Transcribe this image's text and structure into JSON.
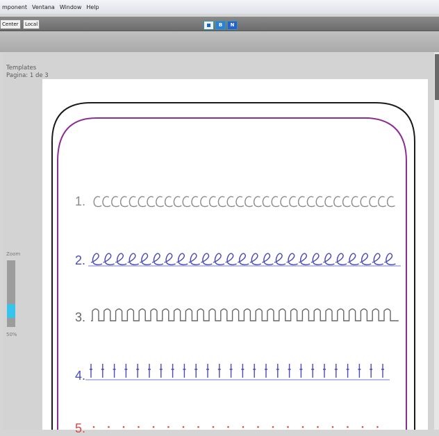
{
  "menubar": {
    "items": [
      "mponent",
      "Ventana",
      "Window",
      "Help"
    ]
  },
  "toolbar": {
    "combo_left": "Center",
    "combo_local": "Local",
    "view_buttons": [
      "",
      "B",
      "N"
    ]
  },
  "side_panel": {
    "title": "Templates",
    "page_info": "Pagina: 1 de 3",
    "zoom_label": "Zoom",
    "zoom_value": "50%",
    "zoom_level": 0.5
  },
  "worksheet": {
    "rows": [
      {
        "number": "1.",
        "pattern": "c-loops",
        "color": "#8a8a8a"
      },
      {
        "number": "2.",
        "pattern": "e-loops",
        "color": "#4a4ab8"
      },
      {
        "number": "3.",
        "pattern": "arches",
        "color": "#666666"
      },
      {
        "number": "4.",
        "pattern": "sticks",
        "color": "#4a4ab8"
      },
      {
        "number": "5.",
        "pattern": "dots",
        "color": "#e04646"
      }
    ],
    "frame_colors": {
      "outer": "#1a1a1a",
      "inner": "#8a2e92"
    }
  },
  "colors": {
    "accent": "#38c4ea",
    "toolbar": "#777777"
  }
}
